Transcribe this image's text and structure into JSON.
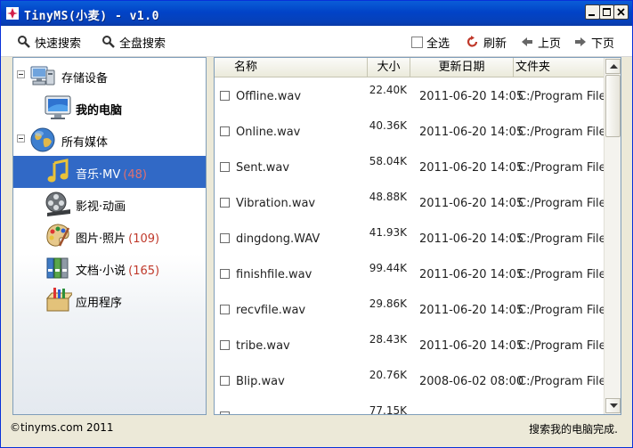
{
  "window": {
    "title": "TinyMS(小麦) - v1.0"
  },
  "toolbar": {
    "quick_search": "快速搜索",
    "full_search": "全盘搜索",
    "select_all": "全选",
    "refresh": "刷新",
    "prev_page": "上页",
    "next_page": "下页"
  },
  "sidebar": {
    "storage_devices": "存储设备",
    "my_computer": "我的电脑",
    "all_media": "所有媒体",
    "music": {
      "label": "音乐·MV",
      "count": "(48)"
    },
    "video": {
      "label": "影视·动画"
    },
    "photos": {
      "label": "图片·照片",
      "count": "(109)"
    },
    "documents": {
      "label": "文档·小说",
      "count": "(165)"
    },
    "apps": {
      "label": "应用程序"
    }
  },
  "table": {
    "columns": {
      "name": "名称",
      "size": "大小",
      "date": "更新日期",
      "folder": "文件夹"
    },
    "rows": [
      {
        "name": "Offline.wav",
        "size": "22.40K",
        "date": "2011-06-20 14:05",
        "folder": "C:/Program Files"
      },
      {
        "name": "Online.wav",
        "size": "40.36K",
        "date": "2011-06-20 14:05",
        "folder": "C:/Program Files"
      },
      {
        "name": "Sent.wav",
        "size": "58.04K",
        "date": "2011-06-20 14:05",
        "folder": "C:/Program Files"
      },
      {
        "name": "Vibration.wav",
        "size": "48.88K",
        "date": "2011-06-20 14:05",
        "folder": "C:/Program Files"
      },
      {
        "name": "dingdong.WAV",
        "size": "41.93K",
        "date": "2011-06-20 14:05",
        "folder": "C:/Program Files"
      },
      {
        "name": "finishfile.wav",
        "size": "99.44K",
        "date": "2011-06-20 14:05",
        "folder": "C:/Program Files"
      },
      {
        "name": "recvfile.wav",
        "size": "29.86K",
        "date": "2011-06-20 14:05",
        "folder": "C:/Program Files"
      },
      {
        "name": "tribe.wav",
        "size": "28.43K",
        "date": "2011-06-20 14:05",
        "folder": "C:/Program Files"
      },
      {
        "name": "Blip.wav",
        "size": "20.76K",
        "date": "2008-06-02 08:00",
        "folder": "C:/Program Files"
      },
      {
        "name": "",
        "size": "77.15K",
        "date": "",
        "folder": ""
      }
    ]
  },
  "statusbar": {
    "copyright": "©tinyms.com 2011",
    "status": "搜索我的电脑完成."
  },
  "colors": {
    "titlebar": "#0143c7",
    "selection": "#3169c6",
    "count_text": "#c0392b"
  }
}
